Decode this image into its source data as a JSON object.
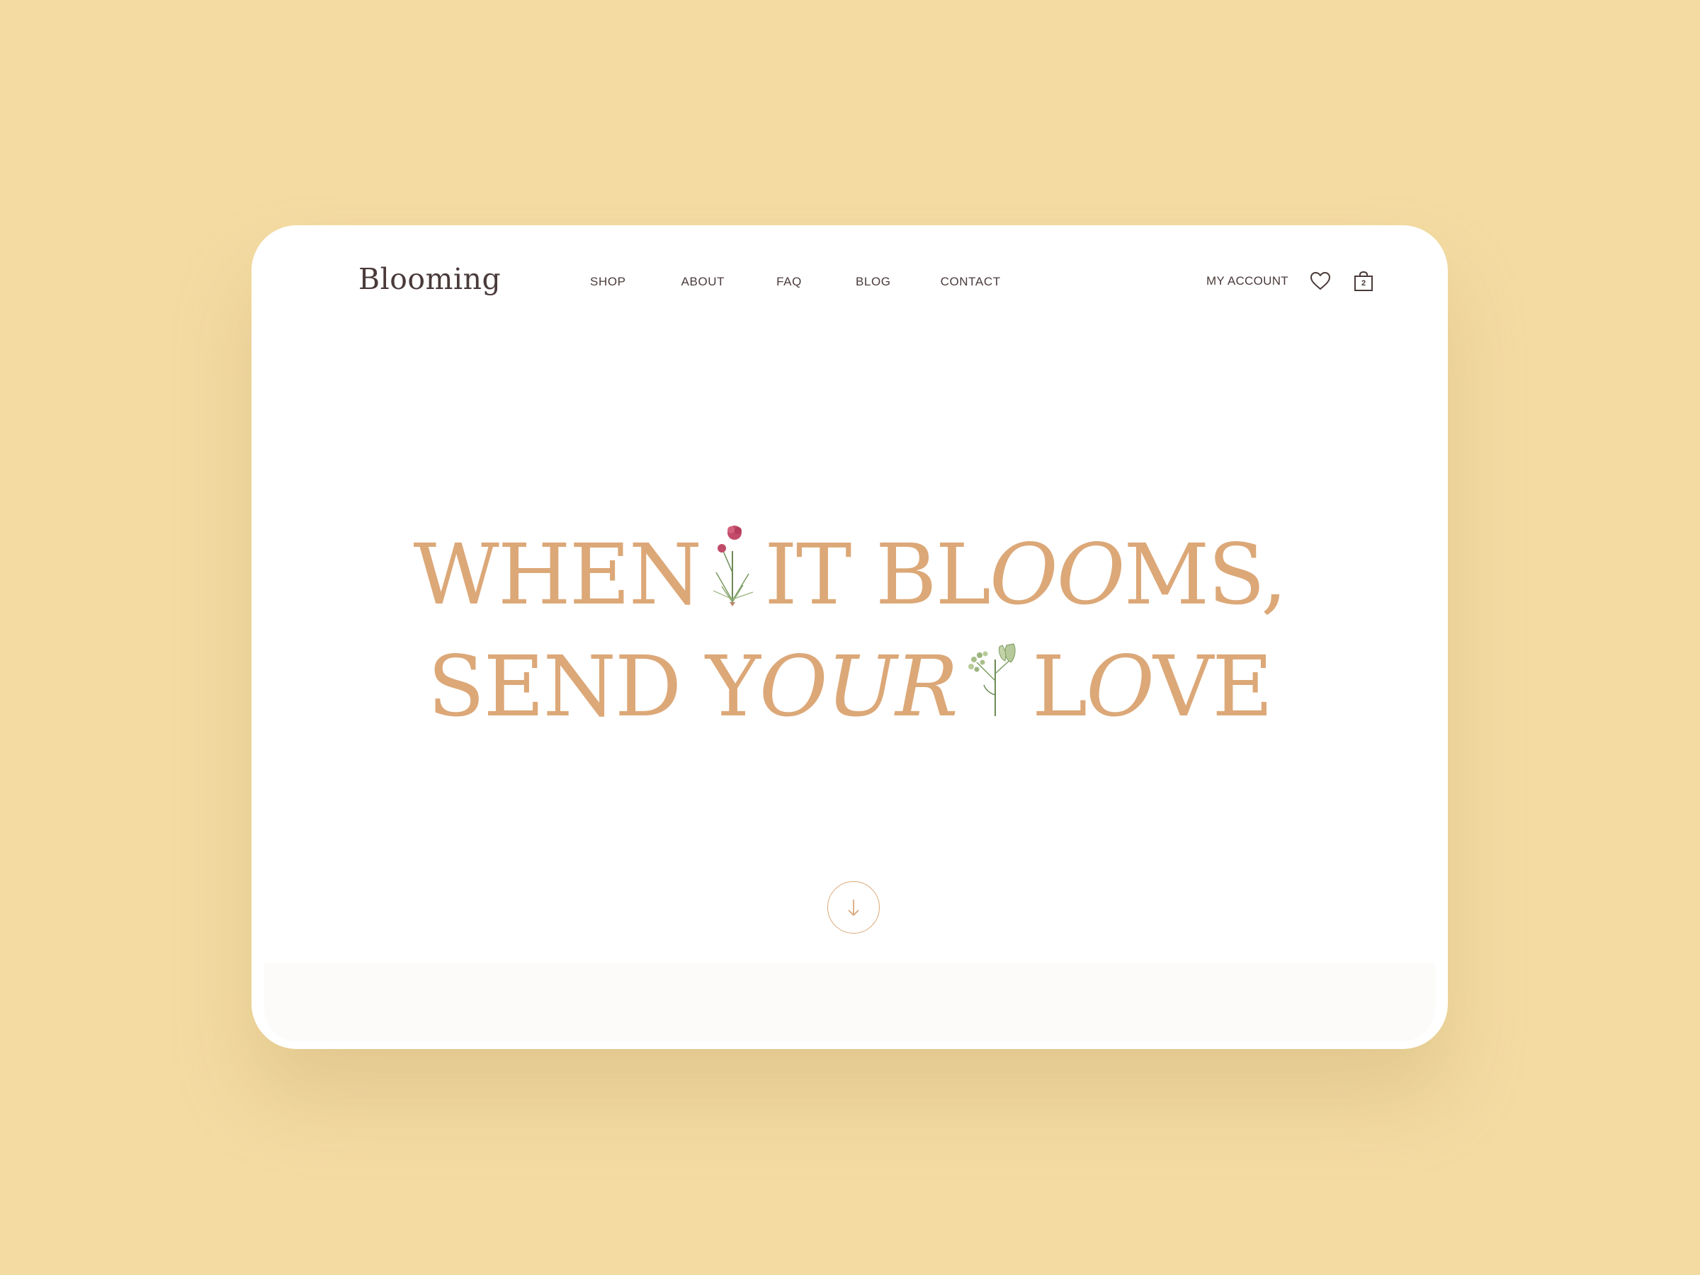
{
  "brand": {
    "logo": "Blooming"
  },
  "nav": {
    "items": [
      {
        "label": "SHOP"
      },
      {
        "label": "ABOUT"
      },
      {
        "label": "FAQ"
      },
      {
        "label": "BLOG"
      },
      {
        "label": "CONTACT"
      }
    ]
  },
  "account": {
    "label": "MY ACCOUNT",
    "cart_count": "2"
  },
  "hero": {
    "line1": {
      "part1": "WHEN",
      "part2": "IT BL",
      "part3": "OO",
      "part4": "MS,"
    },
    "line2": {
      "part1": "SEND Y",
      "part2": "OUR",
      "part3": "L",
      "part4": "O",
      "part5": "VE"
    }
  },
  "icons": {
    "wishlist": "heart-icon",
    "cart": "shopping-bag-icon",
    "scroll": "arrow-down-icon",
    "flower1": "pink-flower-illustration",
    "flower2": "green-flower-illustration"
  },
  "colors": {
    "background": "#f3dba2",
    "accent": "#dca878",
    "text": "#4a3a3a",
    "card": "#ffffff"
  }
}
